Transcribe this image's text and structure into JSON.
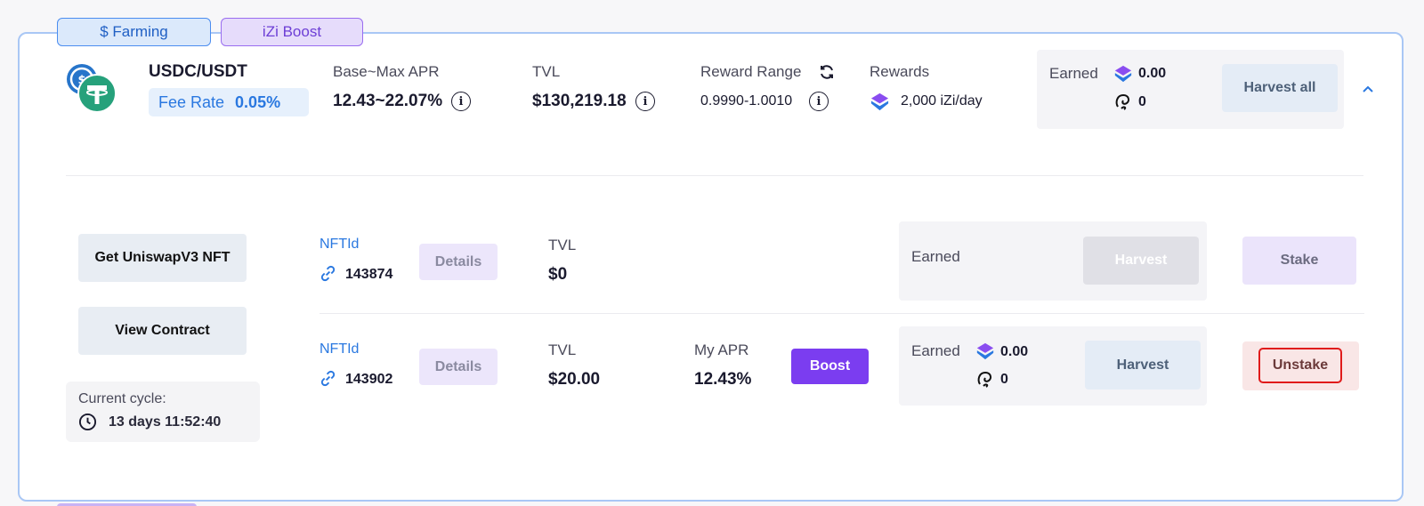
{
  "tags": {
    "farming": "$ Farming",
    "boost": "iZi Boost"
  },
  "pool": {
    "pair": "USDC/USDT",
    "fee_label": "Fee Rate",
    "fee_value": "0.05%",
    "apr_label": "Base~Max APR",
    "apr_value": "12.43~22.07%",
    "tvl_label": "TVL",
    "tvl_value": "$130,219.18",
    "range_label": "Reward Range",
    "range_value": "0.9990-1.0010",
    "rewards_label": "Rewards",
    "rewards_value": "2,000 iZi/day",
    "earned_label": "Earned",
    "earned_izi": "0.00",
    "earned_other": "0",
    "harvest_all": "Harvest all"
  },
  "left": {
    "get_nft": "Get UniswapV3 NFT",
    "view_contract": "View Contract",
    "cycle_label": "Current cycle:",
    "cycle_value": "13 days 11:52:40"
  },
  "positions": [
    {
      "nft_label": "NFTId",
      "nft_id": "143874",
      "details": "Details",
      "tvl_label": "TVL",
      "tvl_value": "$0",
      "earned_label": "Earned",
      "harvest": "Harvest",
      "action": "Stake"
    },
    {
      "nft_label": "NFTId",
      "nft_id": "143902",
      "details": "Details",
      "tvl_label": "TVL",
      "tvl_value": "$20.00",
      "apr_label": "My APR",
      "apr_value": "12.43%",
      "boost": "Boost",
      "earned_label": "Earned",
      "earned_izi": "0.00",
      "earned_other": "0",
      "harvest": "Harvest",
      "action": "Unstake"
    }
  ],
  "colors": {
    "accent_blue": "#2a78e0",
    "accent_purple": "#7b3df0",
    "danger": "#e01b1b",
    "border": "#a9c7f5"
  }
}
